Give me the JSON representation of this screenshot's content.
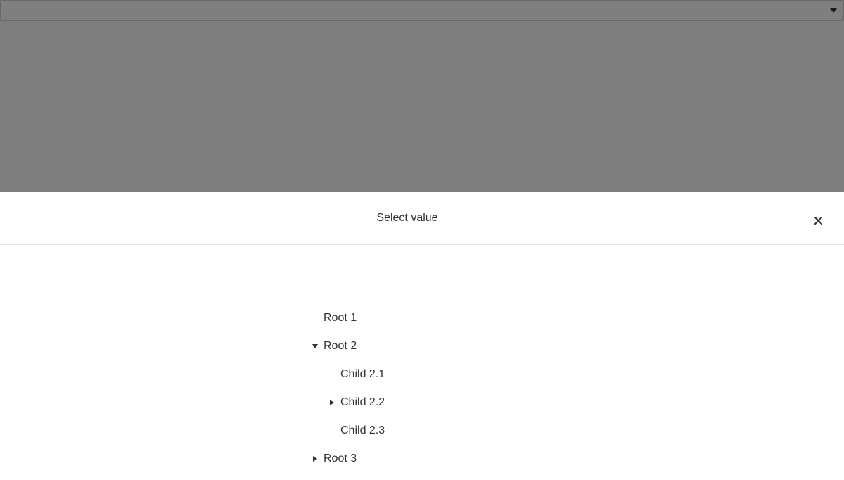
{
  "select": {
    "value": "",
    "icon": "chevron-down-icon"
  },
  "sheet": {
    "title": "Select value",
    "close_icon": "close-icon"
  },
  "tree": {
    "root1": {
      "label": "Root 1",
      "expanded": null
    },
    "root2": {
      "label": "Root 2",
      "expanded": true
    },
    "child21": {
      "label": "Child 2.1",
      "expanded": null
    },
    "child22": {
      "label": "Child 2.2",
      "expanded": false
    },
    "child23": {
      "label": "Child 2.3",
      "expanded": null
    },
    "root3": {
      "label": "Root 3",
      "expanded": false
    }
  },
  "colors": {
    "backdrop": "#7f7f7f",
    "text": "#333333",
    "divider": "#e5e5e5"
  }
}
